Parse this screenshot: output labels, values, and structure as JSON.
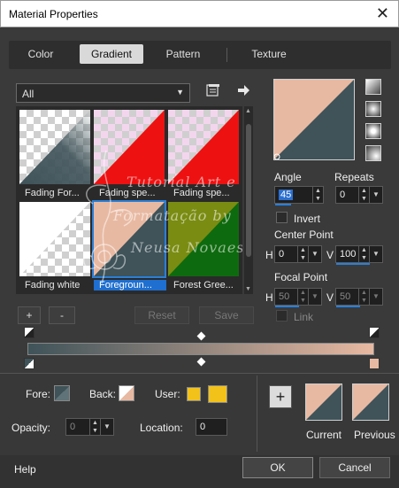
{
  "window": {
    "title": "Material Properties",
    "close_glyph": "✕"
  },
  "tabs": [
    {
      "label": "Color"
    },
    {
      "label": "Gradient",
      "active": true
    },
    {
      "label": "Pattern"
    },
    {
      "label": "Texture"
    }
  ],
  "category_dropdown": {
    "value": "All"
  },
  "gradients": [
    {
      "label": "Fading For..."
    },
    {
      "label": "Fading spe..."
    },
    {
      "label": "Fading spe..."
    },
    {
      "label": "Fading white"
    },
    {
      "label": "Foregroun...",
      "selected": true
    },
    {
      "label": "Forest Gree..."
    }
  ],
  "watermark": {
    "line1": "Tutorial Art e",
    "line2": "Formatação by",
    "line3": "Neusa Novaes"
  },
  "angle": {
    "label": "Angle",
    "value": "45"
  },
  "repeats": {
    "label": "Repeats",
    "value": "0"
  },
  "invert": {
    "label": "Invert"
  },
  "center_point": {
    "label": "Center Point",
    "h_label": "H",
    "h_value": "0",
    "v_label": "V",
    "v_value": "100"
  },
  "focal_point": {
    "label": "Focal Point",
    "h_label": "H",
    "h_value": "50",
    "v_label": "V",
    "v_value": "50"
  },
  "link": {
    "label": "Link"
  },
  "buttons": {
    "add": "+",
    "remove": "-",
    "reset": "Reset",
    "save": "Save",
    "ok": "OK",
    "cancel": "Cancel",
    "help": "Help",
    "add_swatch": "+"
  },
  "fore": {
    "label": "Fore:"
  },
  "back": {
    "label": "Back:"
  },
  "user": {
    "label": "User:"
  },
  "opacity": {
    "label": "Opacity:",
    "value": "0"
  },
  "location": {
    "label": "Location:",
    "value": "0"
  },
  "current": {
    "label": "Current"
  },
  "previous": {
    "label": "Previous"
  },
  "colors": {
    "foreground": "#3f5359",
    "background": "#e8b9a2",
    "user": "#f2c21b",
    "selection": "#1e6fcf"
  }
}
